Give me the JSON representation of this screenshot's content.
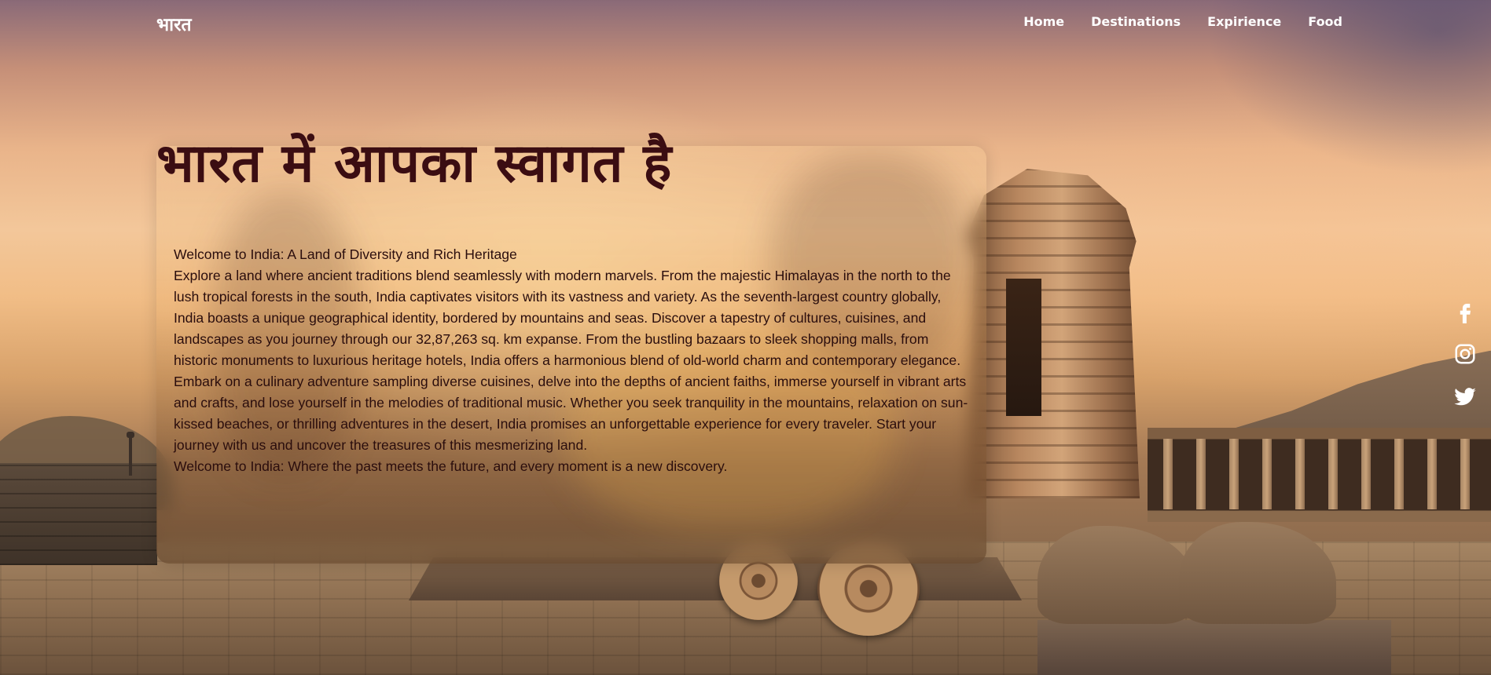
{
  "nav": {
    "logo": "भारत",
    "links": [
      {
        "label": "Home"
      },
      {
        "label": "Destinations"
      },
      {
        "label": "Expirience"
      },
      {
        "label": "Food"
      }
    ]
  },
  "hero": {
    "title": "भारत में आपका स्वागत है",
    "intro_heading": "Welcome to India: A Land of Diversity and Rich Heritage",
    "body": "Explore a land where ancient traditions blend seamlessly with modern marvels. From the majestic Himalayas in the north to the lush tropical forests in the south, India captivates visitors with its vastness and variety. As the seventh-largest country globally, India boasts a unique geographical identity, bordered by mountains and seas. Discover a tapestry of cultures, cuisines, and landscapes as you journey through our 32,87,263 sq. km expanse. From the bustling bazaars to sleek shopping malls, from historic monuments to luxurious heritage hotels, India offers a harmonious blend of old-world charm and contemporary elegance. Embark on a culinary adventure sampling diverse cuisines, delve into the depths of ancient faiths, immerse yourself in vibrant arts and crafts, and lose yourself in the melodies of traditional music. Whether you seek tranquility in the mountains, relaxation on sun-kissed beaches, or thrilling adventures in the desert, India promises an unforgettable experience for every traveler. Start your journey with us and uncover the treasures of this mesmerizing land.",
    "closing": "Welcome to India: Where the past meets the future, and every moment is a new discovery."
  },
  "social": {
    "icons": [
      "facebook-icon",
      "instagram-icon",
      "twitter-icon"
    ]
  },
  "colors": {
    "title": "#3b0d12",
    "body_text": "#2a0d0d",
    "nav_text": "#ffffff"
  }
}
